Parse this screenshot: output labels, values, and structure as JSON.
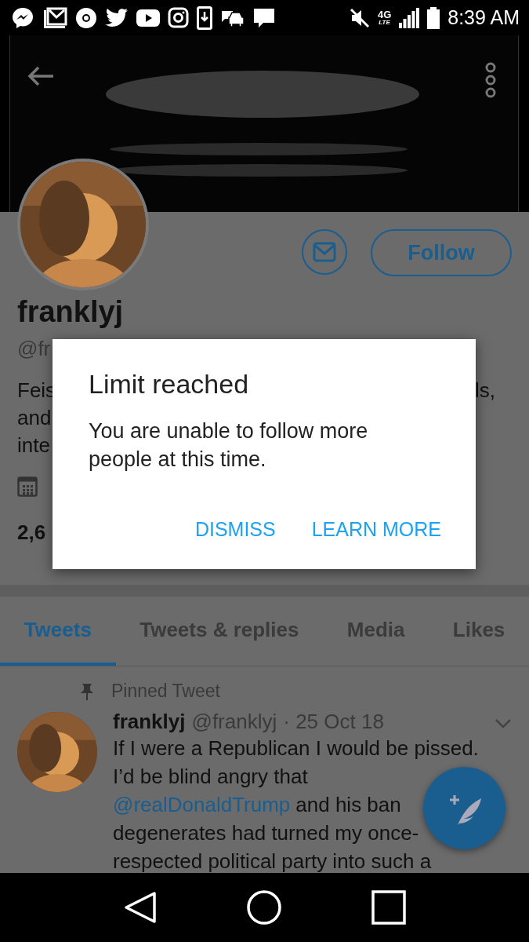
{
  "status_bar": {
    "network": "4G",
    "network_sub": "LTE",
    "time": "8:39 AM"
  },
  "profile": {
    "name": "franklyj",
    "handle": "@fr",
    "follow_button": "Follow",
    "bio_lines": [
      {
        "left": "Feis",
        "right": "ls,"
      },
      {
        "left": "and"
      },
      {
        "left": "inte"
      }
    ],
    "stats": "2,6"
  },
  "dialog": {
    "title": "Limit reached",
    "message": "You are unable to follow more people at this time.",
    "buttons": [
      {
        "label": "DISMISS"
      },
      {
        "label": "LEARN MORE"
      }
    ]
  },
  "tabs": [
    {
      "label": "Tweets",
      "selected": true
    },
    {
      "label": "Tweets & replies",
      "selected": false
    },
    {
      "label": "Media",
      "selected": false
    },
    {
      "label": "Likes",
      "selected": false
    }
  ],
  "tweet": {
    "pinned_label": "Pinned Tweet",
    "author_name": "franklyj",
    "author_handle": "@franklyj",
    "date": "· 25 Oct 18",
    "lines": [
      {
        "text": "If I were a Republican I would be pissed."
      },
      {
        "text": "I’d be blind angry that"
      },
      {
        "mention": "@realDonaldTrump",
        "text": "and his ban"
      },
      {
        "text": "degenerates had turned my once-"
      },
      {
        "text": "respected political party into such a"
      }
    ]
  }
}
